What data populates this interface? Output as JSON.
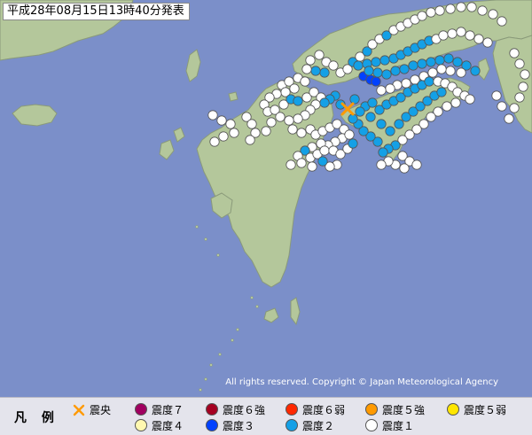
{
  "header": {
    "issued_text": "平成28年08月15日13時40分発表"
  },
  "colors": {
    "sea": "#7b8fc9",
    "land": "#b4c79b",
    "land_border": "#8a9a7a",
    "epicenter": "#ff9a00",
    "int1": "#ffffff",
    "int2": "#14a0e6",
    "int3": "#0041ff",
    "int4": "#fff8b0"
  },
  "epicenter": {
    "symbol": "cross-icon",
    "label": "震央"
  },
  "copyright": "All rights reserved. Copyright © Japan Meteorological Agency",
  "legend": {
    "title": "凡 例",
    "items": [
      {
        "key": "epicenter",
        "label": "震央",
        "color": "#ff9a00",
        "icon": "cross-icon"
      },
      {
        "key": "s7",
        "label": "震度７",
        "color": "#a00060"
      },
      {
        "key": "s6p",
        "label": "震度６強",
        "color": "#a50021"
      },
      {
        "key": "s6m",
        "label": "震度６弱",
        "color": "#ff2800"
      },
      {
        "key": "s5p",
        "label": "震度５強",
        "color": "#ff9a00"
      },
      {
        "key": "s5m",
        "label": "震度５弱",
        "color": "#ffe600"
      },
      {
        "key": "s4",
        "label": "震度４",
        "color": "#fff8b0"
      },
      {
        "key": "s3",
        "label": "震度３",
        "color": "#0041ff"
      },
      {
        "key": "s2",
        "label": "震度２",
        "color": "#14a0e6"
      },
      {
        "key": "s1",
        "label": "震度１",
        "color": "#ffffff"
      }
    ]
  }
}
